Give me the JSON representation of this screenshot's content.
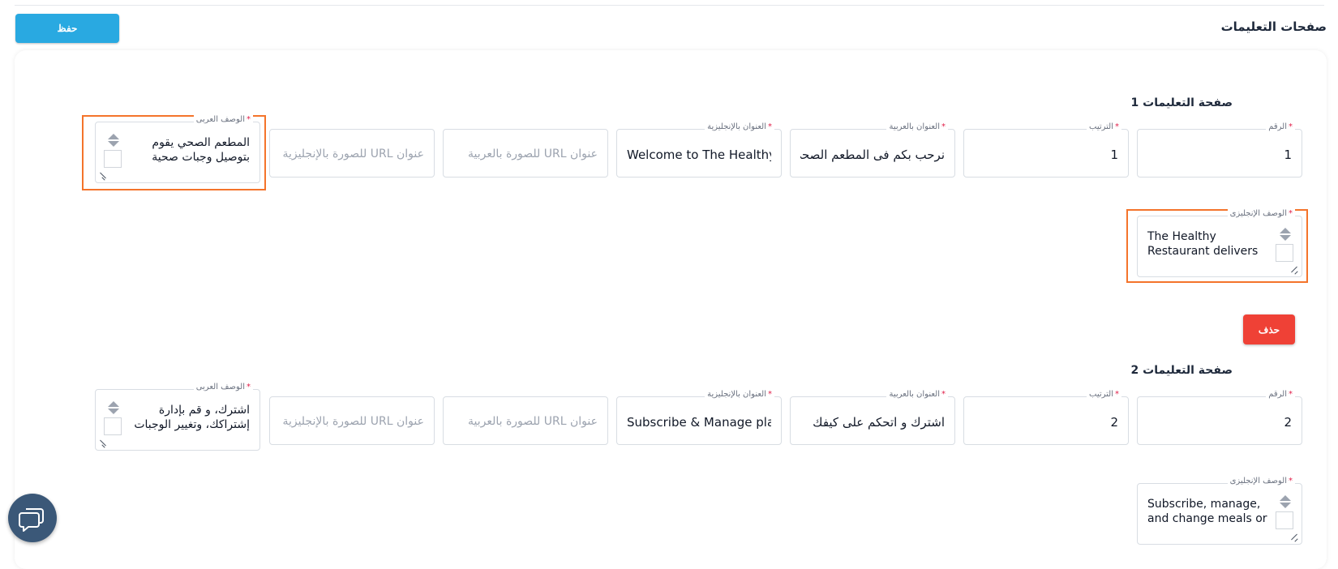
{
  "header": {
    "page_title": "صفحات التعليمات",
    "save_label": "حفظ"
  },
  "labels": {
    "number": "الرقم",
    "order": "الترتيب",
    "title_ar": "العنوان بالعربية",
    "title_en": "العنوان بالإنجليزية",
    "desc_ar": "الوصف العربى",
    "desc_en": "الوصف الإنجليزى",
    "required": "*"
  },
  "placeholders": {
    "image_url_ar": "عنوان URL للصورة بالعربية",
    "image_url_en": "عنوان URL للصورة بالإنجليزية"
  },
  "pages": [
    {
      "title": "صفحة التعليمات 1",
      "number": "1",
      "order": "1",
      "title_ar": "نرحب بكم فى المطعم الصحى",
      "title_en": "Welcome to The Healthy Restaurant",
      "desc_ar": "المطعم الصحي يقوم بتوصيل وجبات صحية",
      "desc_en": "The Healthy Restaurant delivers",
      "delete_label": "حذف"
    },
    {
      "title": "صفحة التعليمات 2",
      "number": "2",
      "order": "2",
      "title_ar": "اشترك و اتحكم على كيفك",
      "title_en": "Subscribe & Manage plan",
      "desc_ar": "اشترك، و قم بإدارة إشتراكك، وتغيير الوجبات",
      "desc_en": "Subscribe, manage, and change meals or"
    }
  ],
  "colors": {
    "save_button": "#29a9e1",
    "delete_button": "#ef4136",
    "highlight": "#f4742b",
    "chat_button": "#3b5878"
  },
  "icons": {
    "chat": "chat-bubbles-icon"
  }
}
